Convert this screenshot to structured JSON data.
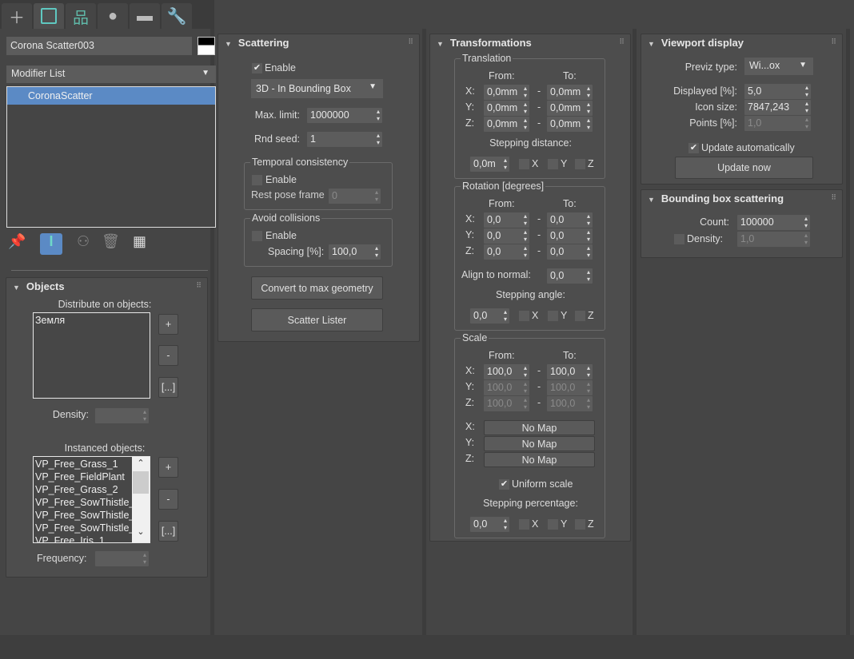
{
  "command_tabs": [
    {
      "icon": "create-icon"
    },
    {
      "icon": "modify-icon",
      "active": true
    },
    {
      "icon": "hierarchy-icon"
    },
    {
      "icon": "motion-icon"
    },
    {
      "icon": "display-icon"
    },
    {
      "icon": "utilities-icon"
    }
  ],
  "object_name": "Corona Scatter003",
  "object_color": "#000000",
  "modifier_list": "Modifier List",
  "stack": [
    {
      "label": "CoronaScatter",
      "selected": true
    }
  ],
  "selection_color": "#5b8ac5",
  "stack_tools": [
    "pin-stack-icon",
    "show-end-result-icon",
    "make-unique-icon",
    "remove-modifier-icon",
    "configure-modifier-sets-icon"
  ],
  "objects": {
    "title": "Objects",
    "distribute_label": "Distribute on objects:",
    "distribute_items": [
      "Земля"
    ],
    "add": "+",
    "remove": "-",
    "pick": "[...]",
    "density_label": "Density:",
    "instanced_label": "Instanced objects:",
    "instanced_items": [
      "VP_Free_Grass_1",
      "VP_Free_FieldPlant",
      "VP_Free_Grass_2",
      "VP_Free_SowThistle_",
      "VP_Free_SowThistle_",
      "VP_Free_SowThistle_",
      "VP_Free_Iris_1"
    ],
    "frequency_label": "Frequency:"
  },
  "scattering": {
    "title": "Scattering",
    "enable": "Enable",
    "enable_checked": true,
    "mode": "3D - In Bounding Box",
    "max_limit_label": "Max. limit:",
    "max_limit": "1000000",
    "rnd_seed_label": "Rnd seed:",
    "rnd_seed": "1",
    "temporal": {
      "title": "Temporal consistency",
      "enable": "Enable",
      "rest_pose_label": "Rest pose frame",
      "rest_pose": "0"
    },
    "avoid": {
      "title": "Avoid collisions",
      "enable": "Enable",
      "spacing_label": "Spacing [%]:",
      "spacing": "100,0"
    },
    "convert_button": "Convert to max geometry",
    "lister_button": "Scatter Lister"
  },
  "transformations": {
    "title": "Transformations",
    "from": "From:",
    "to": "To:",
    "dash": "-",
    "axes": [
      "X:",
      "Y:",
      "Z:"
    ],
    "axis_letters": [
      "X",
      "Y",
      "Z"
    ],
    "translation": {
      "title": "Translation",
      "from": [
        "0,0mm",
        "0,0mm",
        "0,0mm"
      ],
      "to": [
        "0,0mm",
        "0,0mm",
        "0,0mm"
      ],
      "stepping_label": "Stepping distance:",
      "stepping": "0,0m"
    },
    "rotation": {
      "title": "Rotation [degrees]",
      "from": [
        "0,0",
        "0,0",
        "0,0"
      ],
      "to": [
        "0,0",
        "0,0",
        "0,0"
      ],
      "align_label": "Align to normal:",
      "align": "0,0",
      "stepping_label": "Stepping angle:",
      "stepping": "0,0"
    },
    "scale": {
      "title": "Scale",
      "from": [
        "100,0",
        "100,0",
        "100,0"
      ],
      "to": [
        "100,0",
        "100,0",
        "100,0"
      ],
      "maps": [
        "No Map",
        "No Map",
        "No Map"
      ],
      "uniform": "Uniform scale",
      "uniform_checked": true,
      "stepping_label": "Stepping percentage:",
      "stepping": "0,0"
    }
  },
  "viewport": {
    "title": "Viewport display",
    "previz_label": "Previz type:",
    "previz": "Wi...ox",
    "displayed_label": "Displayed [%]:",
    "displayed": "5,0",
    "icon_size_label": "Icon size:",
    "icon_size": "7847,243",
    "points_label": "Points [%]:",
    "points": "1,0",
    "update_auto": "Update automatically",
    "update_auto_checked": true,
    "update_now": "Update now"
  },
  "bbox": {
    "title": "Bounding box scattering",
    "count_label": "Count:",
    "count": "100000",
    "density_label": "Density:",
    "density": "1,0"
  }
}
